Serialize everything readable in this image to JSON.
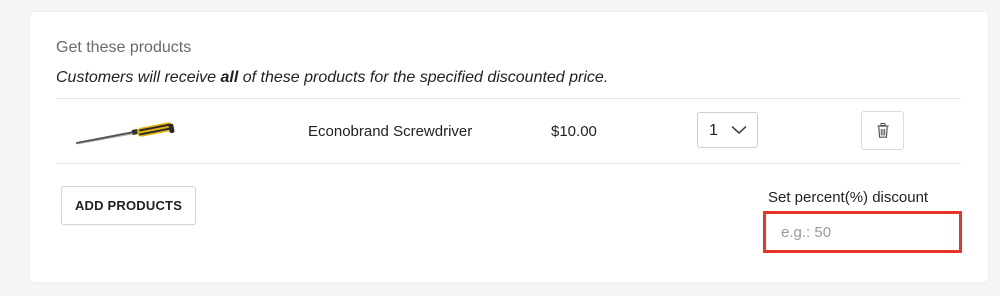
{
  "section": {
    "title": "Get these products",
    "desc_prefix": "Customers will receive ",
    "desc_bold": "all",
    "desc_suffix": " of these products for the specified discounted price."
  },
  "products": [
    {
      "name": "Econobrand Screwdriver",
      "price": "$10.00",
      "quantity": "1",
      "thumbnail_icon": "screwdriver-image"
    }
  ],
  "actions": {
    "add_products_label": "ADD PRODUCTS",
    "delete_icon": "trash-icon"
  },
  "discount": {
    "label": "Set percent(%) discount",
    "value": "",
    "placeholder": "e.g.: 50",
    "highlight_color": "#e8352a"
  }
}
